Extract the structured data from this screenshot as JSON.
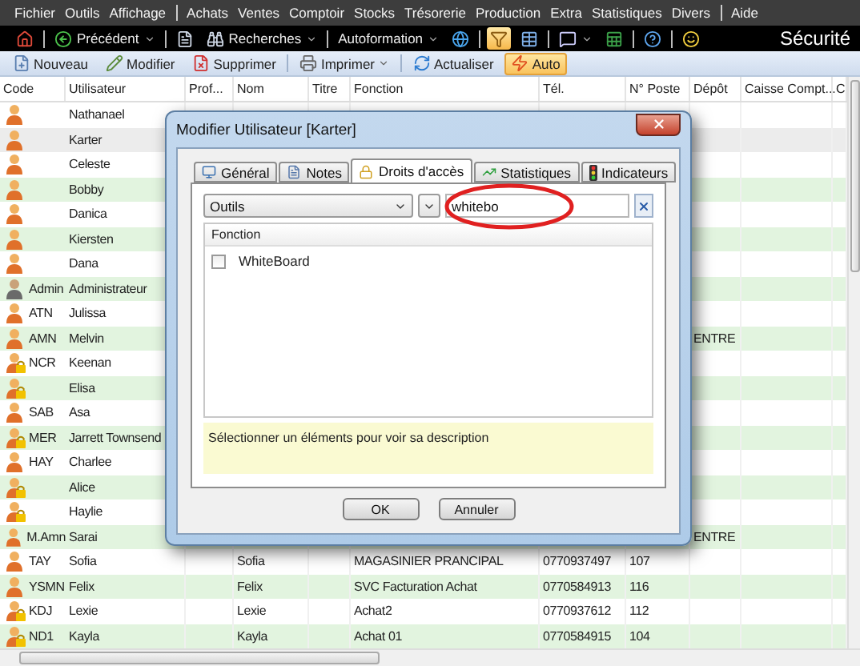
{
  "menu_bar": [
    {
      "label": "Fichier",
      "kind": "item"
    },
    {
      "label": "Outils",
      "kind": "item"
    },
    {
      "label": "Affichage",
      "kind": "item"
    },
    {
      "kind": "separator"
    },
    {
      "label": "Achats",
      "kind": "item"
    },
    {
      "label": "Ventes",
      "kind": "item"
    },
    {
      "label": "Comptoir",
      "kind": "item"
    },
    {
      "label": "Stocks",
      "kind": "item"
    },
    {
      "label": "Trésorerie",
      "kind": "item"
    },
    {
      "label": "Production",
      "kind": "item"
    },
    {
      "label": "Extra",
      "kind": "item"
    },
    {
      "label": "Statistiques",
      "kind": "item"
    },
    {
      "label": "Divers",
      "kind": "item"
    },
    {
      "kind": "separator"
    },
    {
      "label": "Aide",
      "kind": "item"
    }
  ],
  "nav_toolbar": {
    "items": [
      {
        "kind": "home",
        "active": false
      },
      {
        "kind": "separator"
      },
      {
        "kind": "back",
        "label": "Précédent",
        "dropdown": true,
        "active": false
      },
      {
        "kind": "separator"
      },
      {
        "kind": "document",
        "active": false
      },
      {
        "kind": "binoculars",
        "label": "Recherches",
        "dropdown": true,
        "active": false
      },
      {
        "kind": "separator"
      },
      {
        "kind": "text",
        "label": "Autoformation",
        "dropdown": true,
        "active": false
      },
      {
        "kind": "globe",
        "active": false
      },
      {
        "kind": "separator"
      },
      {
        "kind": "filter",
        "active": true
      },
      {
        "kind": "table",
        "active": false
      },
      {
        "kind": "separator"
      },
      {
        "kind": "chat",
        "dropdown": true,
        "active": false
      },
      {
        "kind": "spreadsheet",
        "active": false
      },
      {
        "kind": "separator"
      },
      {
        "kind": "help",
        "active": false
      },
      {
        "kind": "separator"
      },
      {
        "kind": "smiley",
        "active": false
      }
    ],
    "title": "Sécurité"
  },
  "action_toolbar": [
    {
      "kind": "new",
      "label": "Nouveau",
      "active": false
    },
    {
      "kind": "edit",
      "label": "Modifier",
      "active": false
    },
    {
      "kind": "delete",
      "label": "Supprimer",
      "active": false
    },
    {
      "kind": "separator"
    },
    {
      "kind": "print",
      "label": "Imprimer",
      "dropdown": true,
      "active": false
    },
    {
      "kind": "separator"
    },
    {
      "kind": "refresh",
      "label": "Actualiser",
      "active": false
    },
    {
      "kind": "auto",
      "label": "Auto",
      "active": true
    }
  ],
  "table": {
    "columns": [
      "Code",
      "Utilisateur",
      "Prof...",
      "Nom",
      "Titre",
      "Fonction",
      "Tél.",
      "N° Poste",
      "Dépôt",
      "Caisse Compt...",
      "C"
    ],
    "rows": [
      {
        "kind": "user",
        "user": "Nathanael",
        "selected": false
      },
      {
        "kind": "user",
        "user": "Karter",
        "selected": true
      },
      {
        "kind": "user",
        "user": "Celeste",
        "selected": false
      },
      {
        "kind": "user",
        "user": "Bobby",
        "selected": false
      },
      {
        "kind": "user",
        "user": "Danica",
        "selected": false
      },
      {
        "kind": "user",
        "user": "Kiersten",
        "selected": false
      },
      {
        "kind": "user",
        "user": "Dana",
        "selected": false
      },
      {
        "kind": "admin",
        "code": "Admin",
        "user": "Administrateur",
        "selected": false
      },
      {
        "kind": "user",
        "code": "ATN",
        "user": "Julissa",
        "selected": false
      },
      {
        "kind": "user",
        "code": "AMN",
        "user": "Melvin",
        "depot": "ENTRE",
        "selected": false
      },
      {
        "kind": "locked",
        "code": "NCR",
        "user": "Keenan",
        "selected": false
      },
      {
        "kind": "locked",
        "user": "Elisa",
        "selected": false
      },
      {
        "kind": "user",
        "code": "SAB",
        "user": "Asa",
        "selected": false
      },
      {
        "kind": "locked",
        "code": "MER",
        "user": "Jarrett Townsend",
        "selected": false
      },
      {
        "kind": "user",
        "code": "HAY",
        "user": "Charlee",
        "selected": false
      },
      {
        "kind": "locked",
        "user": "Alice",
        "selected": false
      },
      {
        "kind": "locked",
        "user": "Haylie",
        "selected": false
      },
      {
        "kind": "user",
        "code": "M.Amn",
        "user": "Sarai",
        "depot": "ENTRE",
        "selected": false
      },
      {
        "kind": "user",
        "code": "TAY",
        "user": "Sofia",
        "nom": "Sofia",
        "fonction": "MAGASINIER PRANCIPAL",
        "tel": "0770937497",
        "n_poste": "107",
        "selected": false
      },
      {
        "kind": "user",
        "code": "YSMN",
        "user": "Felix",
        "nom": "Felix",
        "fonction": "SVC Facturation Achat",
        "tel": "0770584913",
        "n_poste": "116",
        "selected": false
      },
      {
        "kind": "locked",
        "code": "KDJ",
        "user": "Lexie",
        "nom": "Lexie",
        "fonction": "Achat2",
        "tel": "0770937612",
        "n_poste": "112",
        "selected": false
      },
      {
        "kind": "locked",
        "code": "ND1",
        "user": "Kayla",
        "nom": "Kayla",
        "fonction": "Achat 01",
        "tel": "0770584915",
        "n_poste": "104",
        "selected": false
      }
    ]
  },
  "dialog": {
    "title": "Modifier Utilisateur [Karter]",
    "tabs": [
      {
        "kind": "general",
        "label": "Général",
        "selected": false
      },
      {
        "kind": "notes",
        "label": "Notes",
        "selected": false
      },
      {
        "kind": "rights",
        "label": "Droits d'accès",
        "selected": true
      },
      {
        "kind": "stats",
        "label": "Statistiques",
        "selected": false
      },
      {
        "kind": "indicators",
        "label": "Indicateurs",
        "selected": false
      }
    ],
    "category_select": {
      "value": "Outils"
    },
    "search": {
      "value": "whitebo"
    },
    "list": {
      "column": "Fonction",
      "items": [
        {
          "label": "WhiteBoard",
          "checked": false
        }
      ]
    },
    "description": "Sélectionner un éléments pour voir sa description",
    "buttons": [
      "OK",
      "Annuler"
    ]
  }
}
